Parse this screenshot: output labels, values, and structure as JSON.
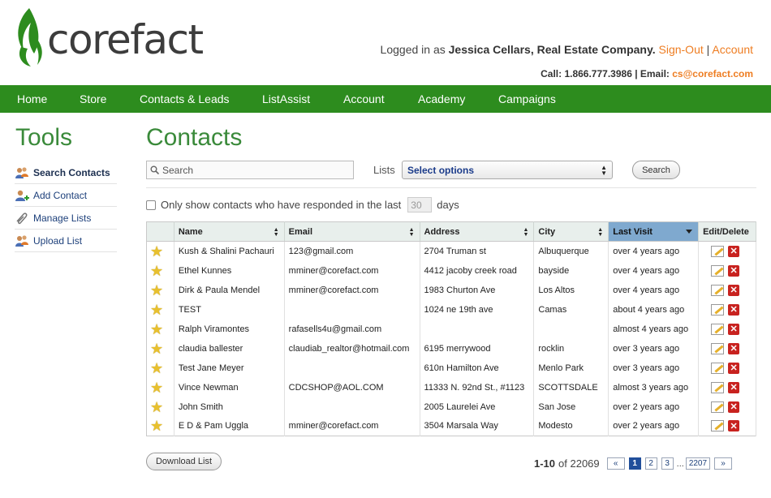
{
  "brand": {
    "name": "corefact",
    "green": "#2d8c1e",
    "orange": "#ee7d22"
  },
  "header": {
    "logged_in_prefix": "Logged in as",
    "user": "Jessica Cellars, Real Estate Company.",
    "signout": "Sign-Out",
    "separator": "|",
    "account": "Account",
    "call_label": "Call: 1.866.777.3986 | Email:",
    "email": "cs@corefact.com"
  },
  "nav": [
    "Home",
    "Store",
    "Contacts & Leads",
    "ListAssist",
    "Account",
    "Academy",
    "Campaigns"
  ],
  "sidebar": {
    "title": "Tools",
    "items": [
      {
        "label": "Search Contacts",
        "icon": "users-search-icon",
        "active": true
      },
      {
        "label": "Add Contact",
        "icon": "user-add-icon",
        "active": false
      },
      {
        "label": "Manage Lists",
        "icon": "paperclip-icon",
        "active": false
      },
      {
        "label": "Upload List",
        "icon": "users-upload-icon",
        "active": false
      }
    ]
  },
  "main": {
    "title": "Contacts",
    "search_placeholder": "Search",
    "lists_label": "Lists",
    "lists_select": "Select options",
    "search_button": "Search",
    "responded_label": "Only show contacts who have responded in the last",
    "days_value": "30",
    "days_label": "days"
  },
  "table": {
    "columns": [
      "Name",
      "Email",
      "Address",
      "City",
      "Last Visit",
      "Edit/Delete"
    ],
    "rows": [
      [
        "Kush & Shalini Pachauri",
        "123@gmail.com",
        "2704 Truman st",
        "Albuquerque",
        "over 4 years ago"
      ],
      [
        "Ethel Kunnes",
        "mminer@corefact.com",
        "4412 jacoby creek road",
        "bayside",
        "over 4 years ago"
      ],
      [
        "Dirk & Paula Mendel",
        "mminer@corefact.com",
        "1983 Churton Ave",
        "Los Altos",
        "over 4 years ago"
      ],
      [
        "TEST",
        "",
        "1024 ne 19th ave",
        "Camas",
        "about 4 years ago"
      ],
      [
        "Ralph Viramontes",
        "rafasells4u@gmail.com",
        "",
        "",
        "almost 4 years ago"
      ],
      [
        "claudia ballester",
        "claudiab_realtor@hotmail.com",
        "6195 merrywood",
        "rocklin",
        "over 3 years ago"
      ],
      [
        "Test Jane Meyer",
        "",
        "610n Hamilton Ave",
        "Menlo Park",
        "over 3 years ago"
      ],
      [
        "Vince Newman",
        "CDCSHOP@AOL.COM",
        "11333 N. 92nd St., #1123",
        "SCOTTSDALE",
        "almost 3 years ago"
      ],
      [
        "John Smith",
        "",
        "2005 Laurelei Ave",
        "San Jose",
        "over 2 years ago"
      ],
      [
        "E D & Pam Uggla",
        "mminer@corefact.com",
        "3504 Marsala Way",
        "Modesto",
        "over 2 years ago"
      ]
    ]
  },
  "footer": {
    "download_button": "Download List",
    "range": "1-10",
    "of_label": "of 22069",
    "pages": [
      "«",
      "1",
      "2",
      "3",
      "...",
      "2207",
      "»"
    ]
  }
}
